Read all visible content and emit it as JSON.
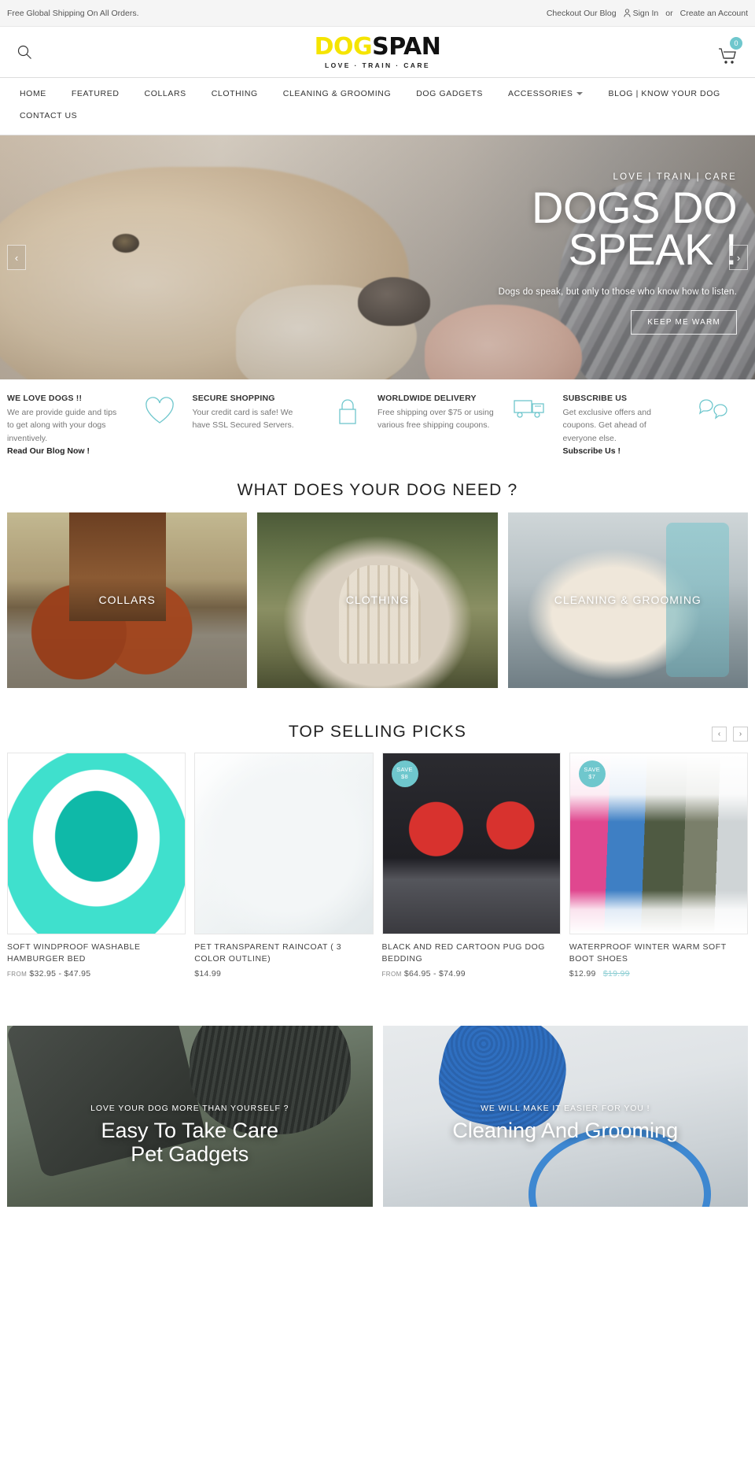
{
  "topbar": {
    "shipping_notice": "Free Global Shipping On All Orders.",
    "blog_link": "Checkout Our Blog",
    "sign_in": "Sign In",
    "or": "or",
    "create_account": "Create an Account"
  },
  "header": {
    "logo_part1": "DOG",
    "logo_part2": "SPAN",
    "logo_tagline": "LOVE · TRAIN · CARE",
    "cart_count": "0"
  },
  "nav": {
    "items": [
      {
        "label": "HOME",
        "has_caret": false
      },
      {
        "label": "FEATURED",
        "has_caret": false
      },
      {
        "label": "COLLARS",
        "has_caret": false
      },
      {
        "label": "CLOTHING",
        "has_caret": false
      },
      {
        "label": "CLEANING & GROOMING",
        "has_caret": false
      },
      {
        "label": "DOG GADGETS",
        "has_caret": false
      },
      {
        "label": "ACCESSORIES",
        "has_caret": true
      },
      {
        "label": "BLOG | KNOW YOUR DOG",
        "has_caret": false
      },
      {
        "label": "CONTACT US",
        "has_caret": false
      }
    ]
  },
  "hero": {
    "eyebrow": "LOVE | TRAIN | CARE",
    "title_line1": "DOGS DO",
    "title_line2": "SPEAK !",
    "subtitle": "Dogs do speak, but only to those who know how to listen.",
    "cta_label": "KEEP ME WARM",
    "prev_arrow": "‹",
    "next_arrow": "›"
  },
  "features": [
    {
      "title": "WE LOVE DOGS !!",
      "desc": "We are provide guide and tips to get along with your dogs inventively.",
      "link": "Read Our Blog Now !",
      "icon": "heart-icon"
    },
    {
      "title": "SECURE SHOPPING",
      "desc": "Your credit card is safe! We have SSL Secured Servers.",
      "link": "",
      "icon": "lock-icon"
    },
    {
      "title": "WORLDWIDE DELIVERY",
      "desc": "Free shipping over $75 or using various free shipping coupons.",
      "link": "",
      "icon": "truck-icon"
    },
    {
      "title": "SUBSCRIBE US",
      "desc": "Get exclusive offers and coupons. Get ahead of everyone else.",
      "link": "Subscribe Us !",
      "icon": "chat-icon"
    }
  ],
  "categories_section": {
    "heading": "WHAT DOES YOUR DOG NEED ?",
    "tiles": [
      {
        "label": "COLLARS"
      },
      {
        "label": "CLOTHING"
      },
      {
        "label": "CLEANING & GROOMING"
      }
    ]
  },
  "top_selling": {
    "heading": "TOP SELLING PICKS",
    "prev_arrow": "‹",
    "next_arrow": "›",
    "products": [
      {
        "name": "SOFT WINDPROOF WASHABLE HAMBURGER BED",
        "from_label": "FROM",
        "price": "$32.95 - $47.95",
        "old_price": "",
        "badge_line1": "",
        "badge_line2": ""
      },
      {
        "name": "PET TRANSPARENT RAINCOAT ( 3 COLOR OUTLINE)",
        "from_label": "",
        "price": "$14.99",
        "old_price": "",
        "badge_line1": "",
        "badge_line2": ""
      },
      {
        "name": "BLACK AND RED CARTOON PUG DOG BEDDING",
        "from_label": "FROM",
        "price": "$64.95 - $74.99",
        "old_price": "",
        "badge_line1": "SAVE",
        "badge_line2": "$8"
      },
      {
        "name": "WATERPROOF WINTER WARM SOFT BOOT SHOES",
        "from_label": "",
        "price": "$12.99",
        "old_price": "$19.99",
        "badge_line1": "SAVE",
        "badge_line2": "$7"
      }
    ]
  },
  "promos": [
    {
      "eyebrow": "LOVE YOUR DOG MORE THAN YOURSELF ?",
      "title_line1": "Easy To Take Care",
      "title_line2": "Pet Gadgets"
    },
    {
      "eyebrow": "WE WILL MAKE IT EASIER FOR YOU !",
      "title_line1": "Cleaning And Grooming",
      "title_line2": ""
    }
  ],
  "colors": {
    "accent": "#6fc7cd",
    "logo_yellow": "#f5e400",
    "text_dark": "#333333"
  }
}
